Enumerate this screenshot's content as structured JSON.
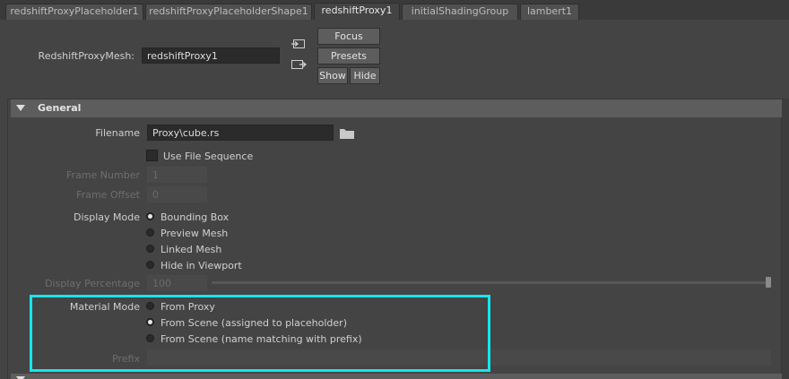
{
  "tabs": [
    {
      "label": "redshiftProxyPlaceholder1",
      "active": false
    },
    {
      "label": "redshiftProxyPlaceholderShape1",
      "active": false
    },
    {
      "label": "redshiftProxy1",
      "active": true
    },
    {
      "label": "initialShadingGroup",
      "active": false
    },
    {
      "label": "lambert1",
      "active": false
    }
  ],
  "mesh": {
    "label": "RedshiftProxyMesh:",
    "value": "redshiftProxy1"
  },
  "buttons": {
    "focus": "Focus",
    "presets": "Presets",
    "show": "Show",
    "hide": "Hide"
  },
  "general": {
    "title": "General",
    "filename_label": "Filename",
    "filename_value": "Proxy\\cube.rs",
    "use_file_sequence": "Use File Sequence",
    "frame_number_label": "Frame Number",
    "frame_number_value": "1",
    "frame_offset_label": "Frame Offset",
    "frame_offset_value": "0",
    "display_mode_label": "Display Mode",
    "display_modes": [
      "Bounding Box",
      "Preview Mesh",
      "Linked Mesh",
      "Hide in Viewport"
    ],
    "display_mode_selected": "Bounding Box",
    "display_percentage_label": "Display Percentage",
    "display_percentage_value": "100",
    "material_mode_label": "Material Mode",
    "material_modes": [
      "From Proxy",
      "From Scene (assigned to placeholder)",
      "From Scene (name matching with prefix)"
    ],
    "material_mode_selected": "From Scene (assigned to placeholder)",
    "prefix_label": "Prefix"
  },
  "colors": {
    "highlight": "#16e6ee",
    "background": "#444444"
  },
  "icons": [
    "connect-input-icon",
    "connect-output-icon",
    "folder-icon"
  ]
}
